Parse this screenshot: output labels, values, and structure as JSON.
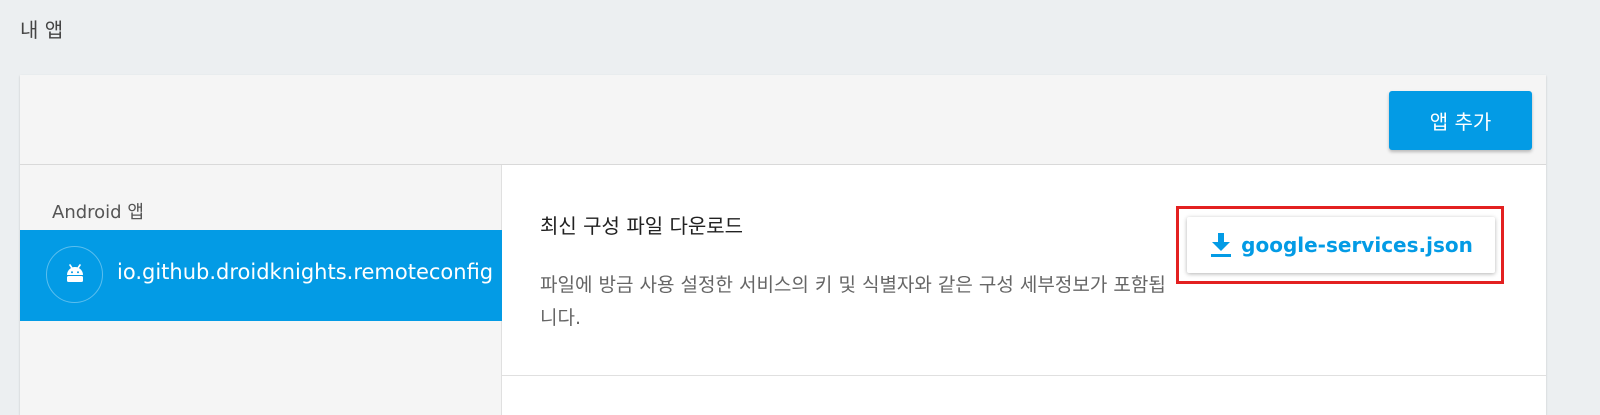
{
  "page": {
    "title": "내 앱"
  },
  "header": {
    "add_app_label": "앱 추가"
  },
  "sidebar": {
    "heading": "Android 앱",
    "apps": [
      {
        "name": "io.github.droidknights.remoteconfig",
        "icon": "android-icon",
        "selected": true
      }
    ]
  },
  "config_section": {
    "title": "최신 구성 파일 다운로드",
    "description": "파일에 방금 사용 설정한 서비스의 키 및 식별자와 같은 구성 세부정보가 포함됩니다.",
    "download_label": "google-services.json",
    "download_icon": "download-icon"
  },
  "colors": {
    "accent": "#039be5",
    "highlight": "#e32020",
    "background": "#eceff1"
  }
}
